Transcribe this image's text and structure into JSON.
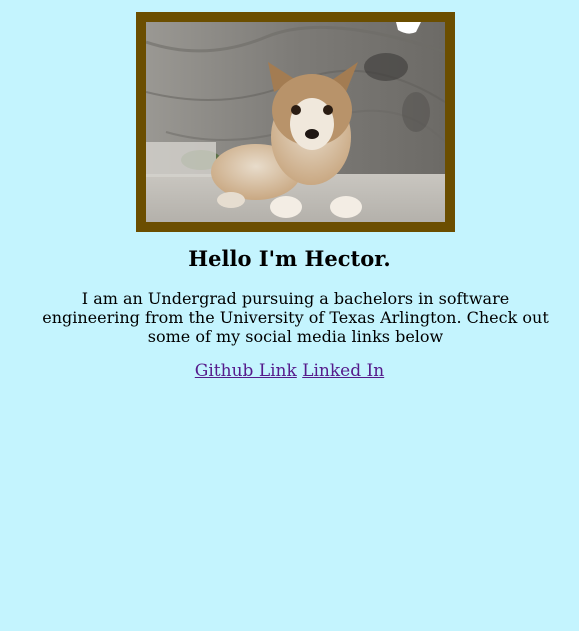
{
  "profile": {
    "heading": "Hello I'm Hector.",
    "intro": "I am an Undergrad pursuing a bachelors in software engineering from the University of Texas Arlington. Check out some of my social media links below"
  },
  "links": {
    "github_label": "Github Link",
    "linkedin_label": "Linked In"
  },
  "colors": {
    "background": "#c4f4fe",
    "frame": "#6b4e00",
    "link_visited": "#551a8b"
  }
}
